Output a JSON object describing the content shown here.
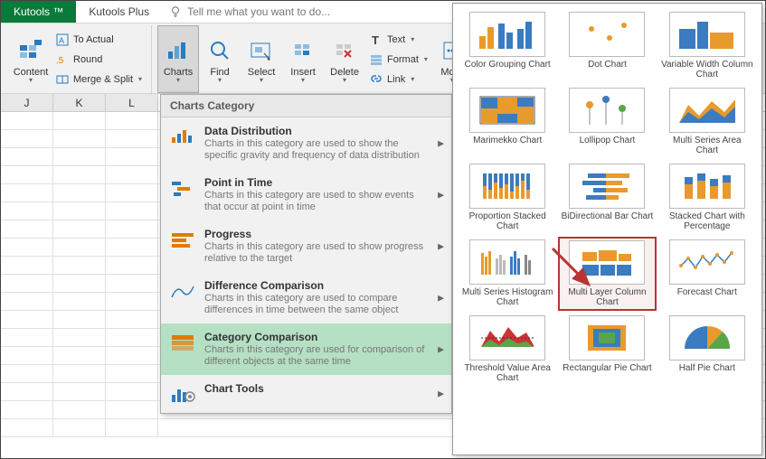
{
  "tabs": {
    "active": "Kutools ™",
    "second": "Kutools Plus"
  },
  "tellme": "Tell me what you want to do...",
  "ribbon": {
    "content": "Content",
    "toactual": "To Actual",
    "round": "Round",
    "mergesplit": "Merge & Split",
    "charts": "Charts",
    "find": "Find",
    "select": "Select",
    "insert": "Insert",
    "delete": "Delete",
    "text": "Text",
    "format": "Format",
    "link": "Link",
    "more": "More"
  },
  "cols": [
    "J",
    "K",
    "L"
  ],
  "dropdown": {
    "header": "Charts Category",
    "items": [
      {
        "title": "Data Distribution",
        "desc": "Charts in this category are used to show the specific gravity and frequency of data distribution"
      },
      {
        "title": "Point in Time",
        "desc": "Charts in this category are used to show events that occur at point in time"
      },
      {
        "title": "Progress",
        "desc": "Charts in this category are used to show progress relative to the target"
      },
      {
        "title": "Difference Comparison",
        "desc": "Charts in this category are used to compare differences in time between the same object"
      },
      {
        "title": "Category Comparison",
        "desc": "Charts in this category are used for comparison of different objects at the same time"
      },
      {
        "title": "Chart Tools",
        "desc": ""
      }
    ]
  },
  "gallery": [
    "Color Grouping Chart",
    "Dot Chart",
    "Variable Width Column Chart",
    "Marimekko Chart",
    "Lollipop Chart",
    "Multi Series Area Chart",
    "Proportion Stacked Chart",
    "BiDirectional Bar Chart",
    "Stacked Chart with Percentage",
    "Multi Series Histogram Chart",
    "Multi Layer Column Chart",
    "Forecast Chart",
    "Threshold Value Area Chart",
    "Rectangular Pie Chart",
    "Half Pie Chart"
  ]
}
